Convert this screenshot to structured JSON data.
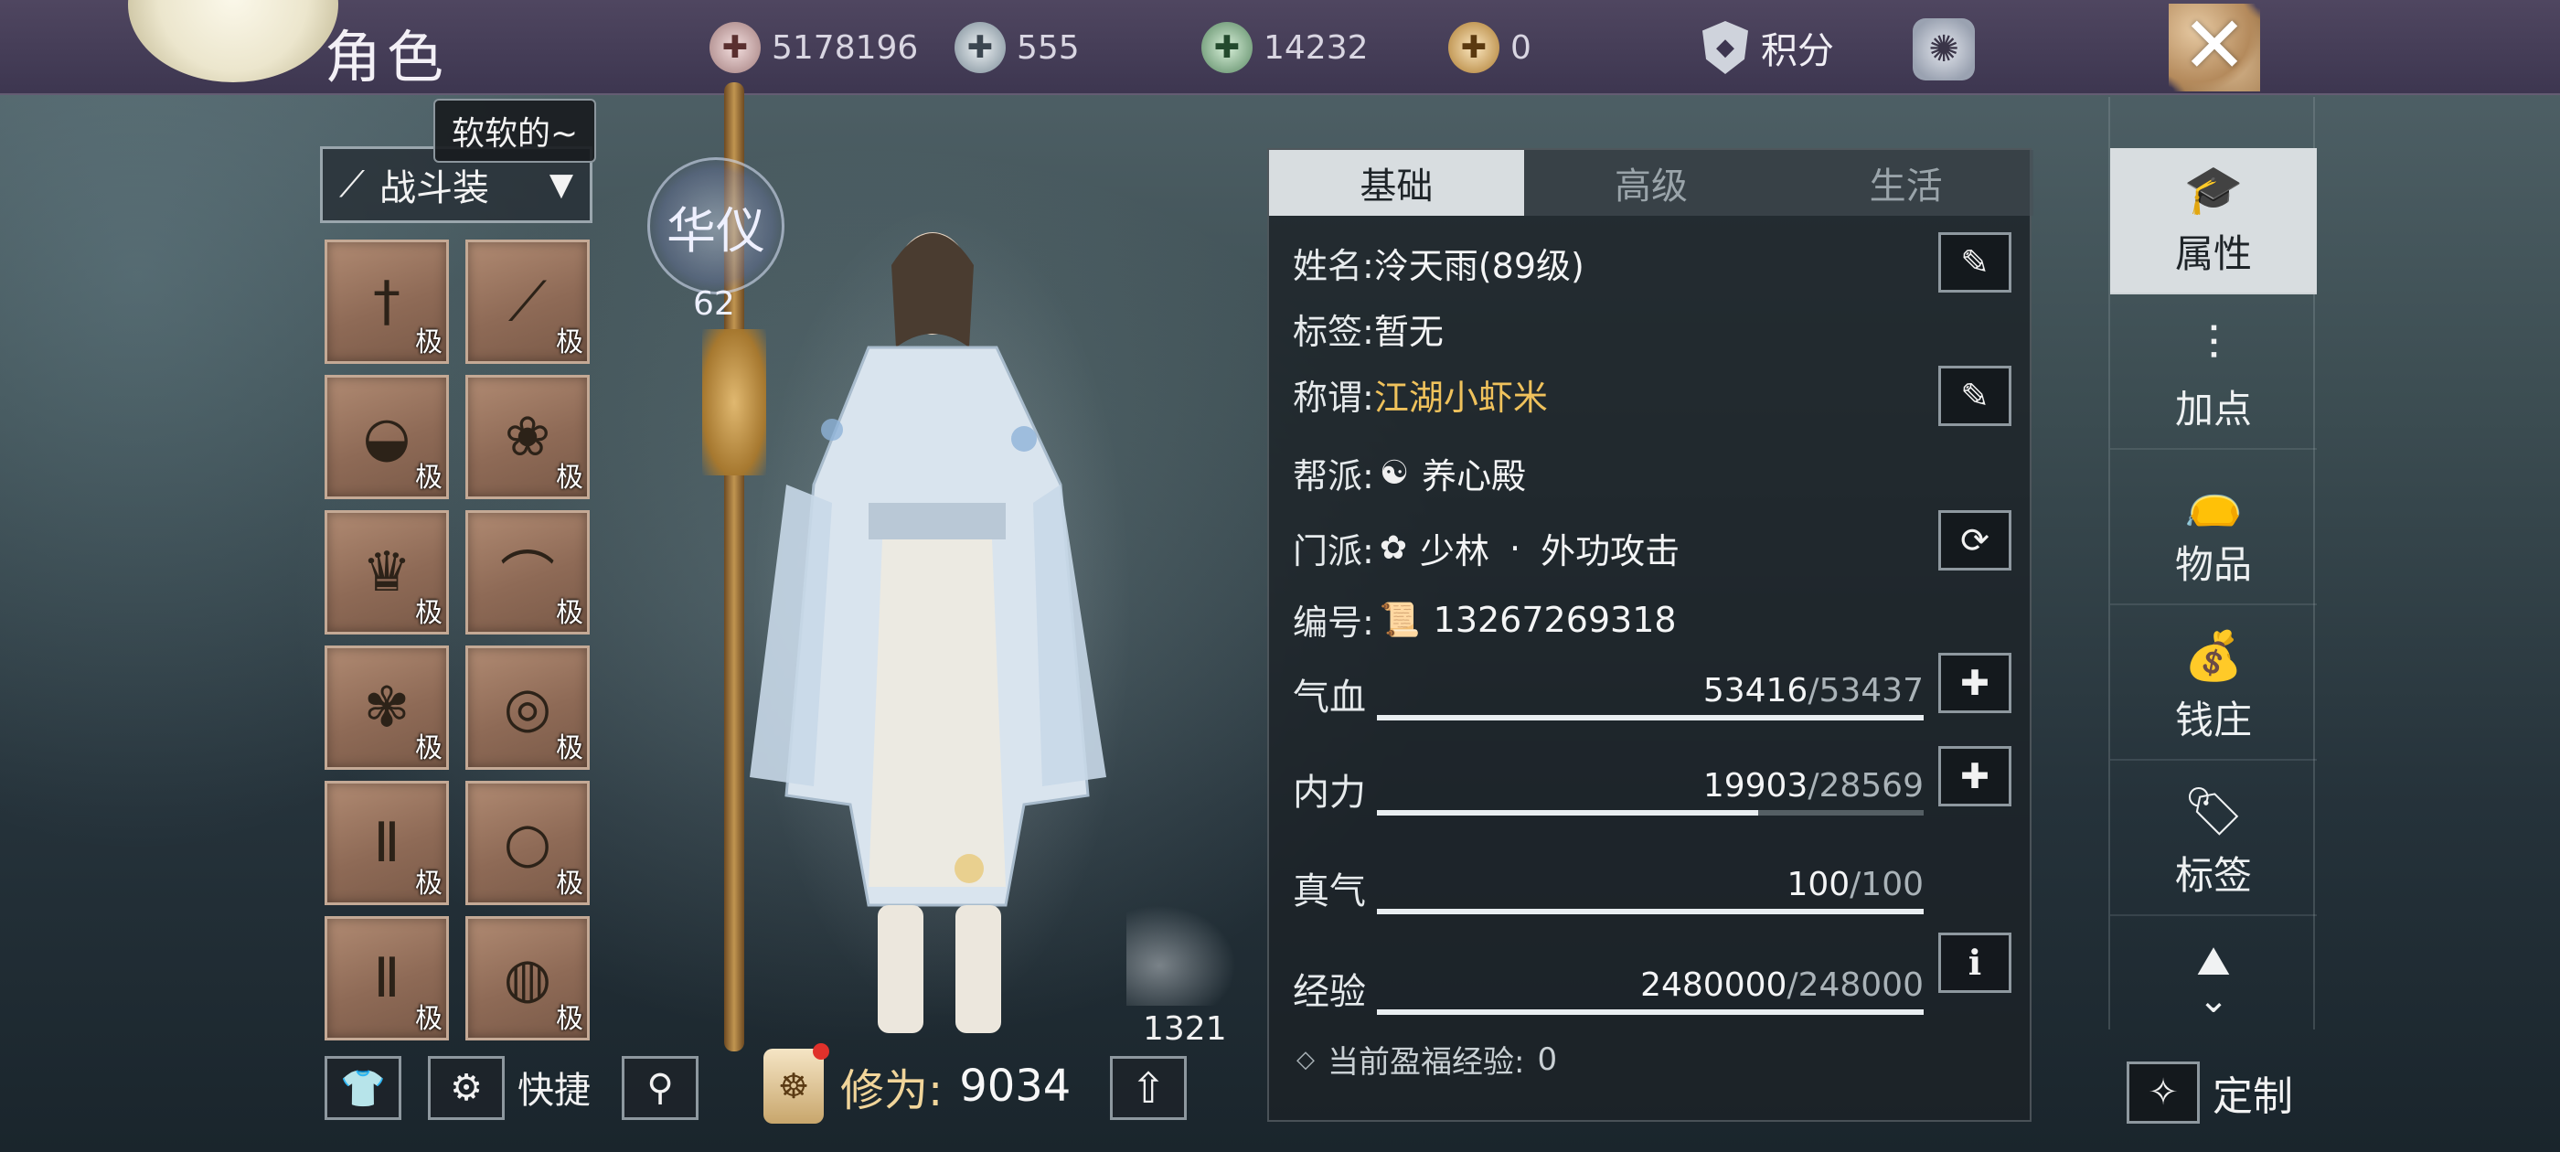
{
  "header": {
    "title": "角色",
    "currencies": [
      {
        "icon": "copper-coin-plus-icon",
        "value": "5178196"
      },
      {
        "icon": "silver-ingot-plus-icon",
        "value": "555"
      },
      {
        "icon": "jade-plus-icon",
        "value": "14232"
      },
      {
        "icon": "gold-ingot-plus-icon",
        "value": "0"
      }
    ],
    "points_label": "积分"
  },
  "equipment": {
    "tooltip": "软软的~",
    "loadout_label": "战斗装",
    "grade_label": "极",
    "slots": [
      {
        "name": "weapon-main",
        "glyph": "†"
      },
      {
        "name": "weapon-hidden",
        "glyph": "⟋"
      },
      {
        "name": "hat",
        "glyph": "◒"
      },
      {
        "name": "jade-pendant",
        "glyph": "❀"
      },
      {
        "name": "armor",
        "glyph": "♛"
      },
      {
        "name": "bracer",
        "glyph": "⌒"
      },
      {
        "name": "belt",
        "glyph": "✾"
      },
      {
        "name": "bracelet",
        "glyph": "◎"
      },
      {
        "name": "pants",
        "glyph": "Ⅱ"
      },
      {
        "name": "ring",
        "glyph": "○"
      },
      {
        "name": "boots",
        "glyph": "Ⅱ"
      },
      {
        "name": "amulet",
        "glyph": "◍"
      }
    ],
    "quick_label": "快捷"
  },
  "character": {
    "emblem_text": "华仪",
    "emblem_level": "62",
    "fan_level": "1321",
    "cultivation_label": "修为:",
    "cultivation_value": "9034"
  },
  "info": {
    "tabs": [
      "基础",
      "高级",
      "生活"
    ],
    "active_tab": "基础",
    "name_label": "姓名:",
    "name_value": "泠天雨(89级)",
    "tag_label": "标签:",
    "tag_value": "暂无",
    "title_label": "称谓:",
    "title_value": "江湖小虾米",
    "guild_label": "帮派:",
    "guild_value": "养心殿",
    "sect_label": "门派:",
    "sect_value": "少林",
    "sect_separator": "·",
    "sect_role": "外功攻击",
    "id_label": "编号:",
    "id_value": "13267269318",
    "stats": [
      {
        "key": "hp",
        "label": "气血",
        "current": 53416,
        "max": 53437,
        "current_text": "53416",
        "max_text": "/53437"
      },
      {
        "key": "mp",
        "label": "内力",
        "current": 19903,
        "max": 28569,
        "current_text": "19903",
        "max_text": "/28569"
      },
      {
        "key": "qi",
        "label": "真气",
        "current": 100,
        "max": 100,
        "current_text": "100",
        "max_text": "/100"
      },
      {
        "key": "exp",
        "label": "经验",
        "current": 2480000,
        "max": 248000,
        "current_text": "2480000",
        "max_text": "/248000"
      }
    ],
    "bonus_exp_label": "当前盈福经验:",
    "bonus_exp_value": "0"
  },
  "sidebar": {
    "items": [
      {
        "label": "属性",
        "icon": "scholar-hat-icon",
        "active": true
      },
      {
        "label": "加点",
        "icon": "sliders-icon",
        "active": false
      },
      {
        "label": "物品",
        "icon": "bag-icon",
        "active": false
      },
      {
        "label": "钱庄",
        "icon": "money-bag-icon",
        "active": false
      },
      {
        "label": "标签",
        "icon": "tag-icon",
        "active": false
      }
    ]
  },
  "customize_label": "定制",
  "colors": {
    "accent_gold": "#f0c25c",
    "tab_active_bg": "#d8dde0",
    "topbar": "#4f4660"
  }
}
